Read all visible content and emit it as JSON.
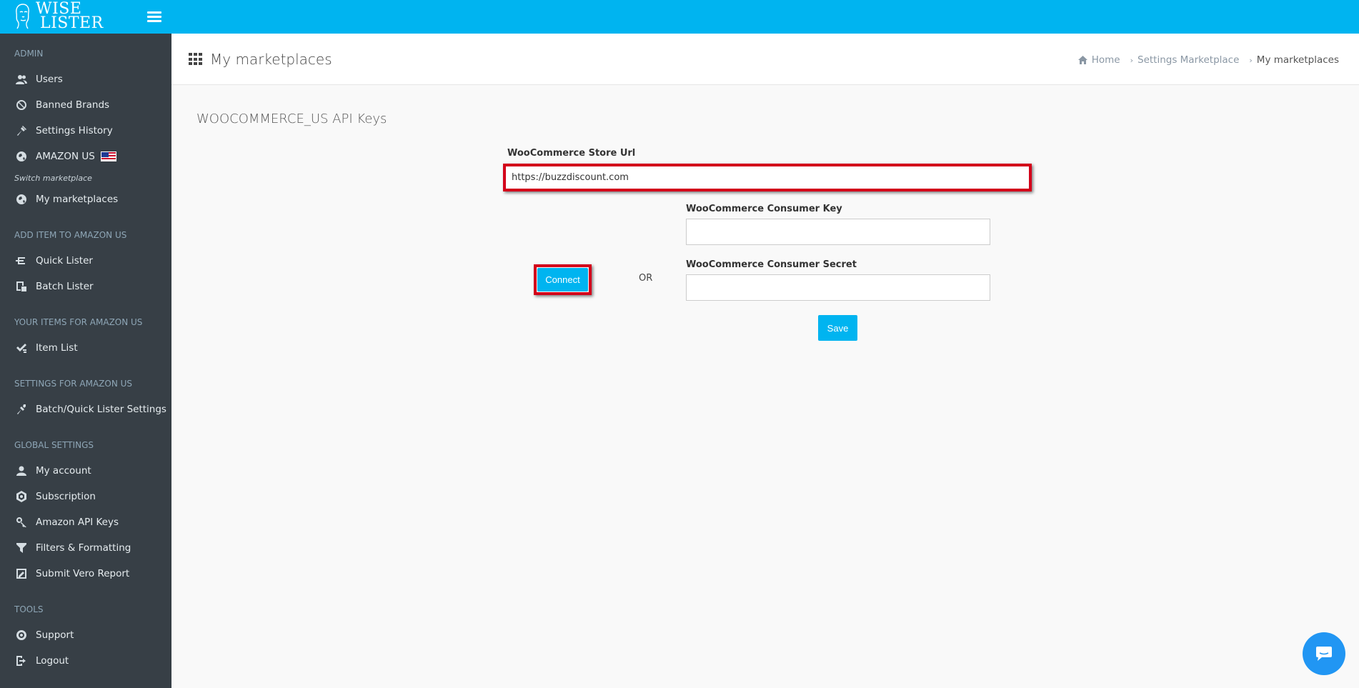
{
  "brand": {
    "line1": "WISE",
    "line2": "LISTER"
  },
  "header": {
    "title": "My marketplaces",
    "breadcrumb": [
      "Home",
      "Settings Marketplace",
      "My marketplaces"
    ]
  },
  "sidebar": {
    "admin": {
      "section": "ADMIN",
      "items": [
        {
          "label": "Users",
          "icon": "users-icon"
        },
        {
          "label": "Banned Brands",
          "icon": "ban-icon"
        },
        {
          "label": "Settings History",
          "icon": "history-icon"
        },
        {
          "label": "AMAZON US",
          "icon": "globe-icon"
        }
      ],
      "switch_label": "Switch marketplace",
      "marketplaces": {
        "label": "My marketplaces",
        "icon": "globe-icon"
      }
    },
    "add_item": {
      "section": "ADD ITEM TO AMAZON US",
      "items": [
        {
          "label": "Quick Lister",
          "icon": "quick-lister-icon"
        },
        {
          "label": "Batch Lister",
          "icon": "batch-lister-icon"
        }
      ]
    },
    "your_items": {
      "section": "YOUR ITEMS FOR AMAZON US",
      "items": [
        {
          "label": "Item List",
          "icon": "checklist-icon"
        }
      ]
    },
    "settings_for": {
      "section": "SETTINGS FOR AMAZON US",
      "items": [
        {
          "label": "Batch/Quick Lister Settings",
          "icon": "tools-icon"
        }
      ]
    },
    "global": {
      "section": "GLOBAL SETTINGS",
      "items": [
        {
          "label": "My account",
          "icon": "user-icon"
        },
        {
          "label": "Subscription",
          "icon": "subscription-icon"
        },
        {
          "label": "Amazon API Keys",
          "icon": "key-icon"
        },
        {
          "label": "Filters & Formatting",
          "icon": "filter-icon"
        },
        {
          "label": "Submit Vero Report",
          "icon": "report-icon"
        }
      ]
    },
    "tools": {
      "section": "TOOLS",
      "items": [
        {
          "label": "Support",
          "icon": "lifebuoy-icon"
        },
        {
          "label": "Logout",
          "icon": "logout-icon"
        }
      ]
    }
  },
  "form": {
    "section_title": "WOOCOMMERCE_US API Keys",
    "store_url_label": "WooCommerce Store Url",
    "store_url_value": "https://buzzdiscount.com",
    "connect_label": "Connect",
    "or_label": "OR",
    "consumer_key_label": "WooCommerce Consumer Key",
    "consumer_key_value": "",
    "consumer_secret_label": "WooCommerce Consumer Secret",
    "consumer_secret_value": "",
    "save_label": "Save"
  },
  "colors": {
    "accent": "#00b4f0",
    "sidebar_bg": "#373f46",
    "highlight": "#d3001a",
    "chat": "#2196f3"
  }
}
